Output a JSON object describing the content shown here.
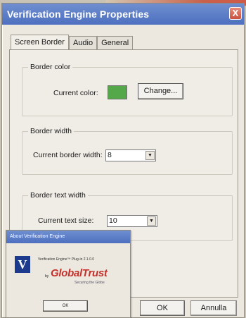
{
  "window": {
    "title": "Verification Engine Properties",
    "close_label": "X"
  },
  "tabs": [
    {
      "label": "Screen Border"
    },
    {
      "label": "Audio"
    },
    {
      "label": "General"
    }
  ],
  "border_color": {
    "group_label": "Border color",
    "current_color_label": "Current color:",
    "swatch_color": "#55a84a",
    "change_button": "Change..."
  },
  "border_width": {
    "group_label": "Border width",
    "current_label": "Current border width:",
    "value": "8"
  },
  "border_text_width": {
    "group_label": "Border text width",
    "current_label": "Current text size:",
    "value": "10"
  },
  "buttons": {
    "ok": "OK",
    "cancel": "Annulla"
  },
  "about": {
    "title": "About Verification Engine",
    "logo_letter": "V",
    "version_text": "Verification Engine™ Plug-in 2.1.0.0",
    "by_text": "by",
    "brand": "GlobalTrust",
    "tagline": "Securing the Globe",
    "ok_label": "OK"
  },
  "colors": {
    "titlebar": "#5a7cc8",
    "brand": "#c5302b",
    "swatch": "#55a84a"
  }
}
